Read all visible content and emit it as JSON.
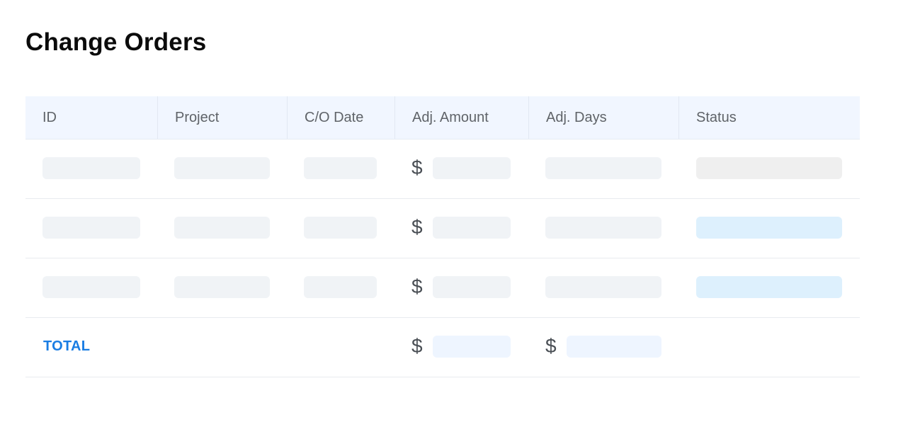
{
  "page": {
    "title": "Change Orders"
  },
  "table": {
    "columns": [
      {
        "key": "id",
        "label": "ID"
      },
      {
        "key": "project",
        "label": "Project"
      },
      {
        "key": "co_date",
        "label": "C/O Date"
      },
      {
        "key": "adj_amount",
        "label": "Adj. Amount"
      },
      {
        "key": "adj_days",
        "label": "Adj. Days"
      },
      {
        "key": "status",
        "label": "Status"
      }
    ],
    "currency_symbol": "$",
    "rows": [
      {
        "status_color": "#efefef"
      },
      {
        "status_color": "#ddf0fd"
      },
      {
        "status_color": "#ddf0fd"
      }
    ],
    "total": {
      "label": "TOTAL",
      "amount_symbol": "$",
      "days_symbol": "$"
    }
  },
  "colors": {
    "accent": "#1a7de3",
    "header_bg": "#f1f6ff",
    "placeholder": "#f0f3f6",
    "total_placeholder": "#eef5ff"
  }
}
